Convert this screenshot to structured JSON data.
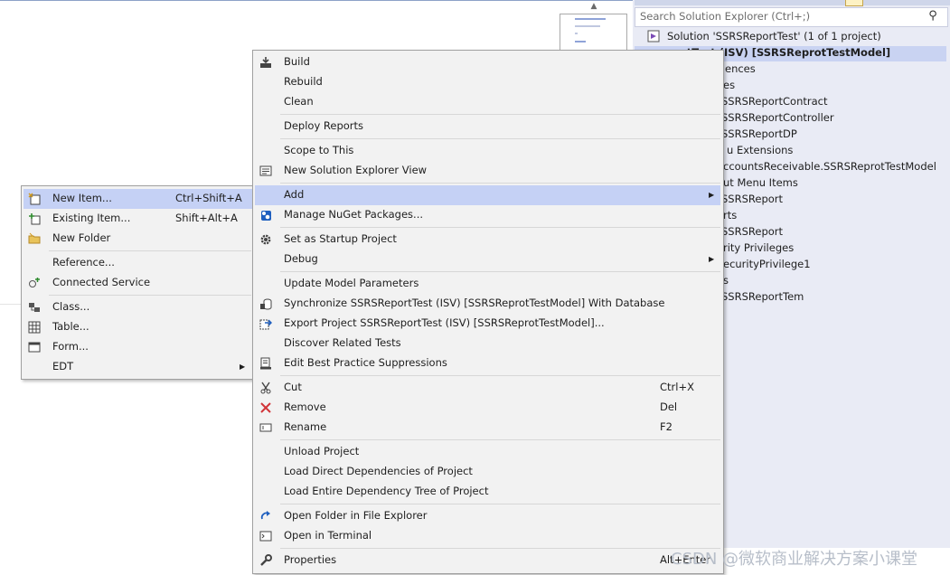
{
  "solution_explorer": {
    "search_placeholder": "Search Solution Explorer (Ctrl+;)",
    "items": [
      "Solution 'SSRSReportTest' (1 of 1 project)",
      "portTest (ISV) [SSRSReprotTestModel]",
      "ences",
      "es",
      "SSRSReportContract",
      "SSRSReportController",
      "SSRSReportDP",
      "u Extensions",
      "ccountsReceivable.SSRSReprotTestModel",
      "ut Menu Items",
      "SSRSReport",
      "rts",
      "SSRSReport",
      "rity Privileges",
      "ecurityPrivilege1",
      "s",
      "SSRSReportTem"
    ]
  },
  "context_menu": {
    "build": "Build",
    "rebuild": "Rebuild",
    "clean": "Clean",
    "deploy_reports": "Deploy Reports",
    "scope_to_this": "Scope to This",
    "new_solution_explorer_view": "New Solution Explorer View",
    "add": "Add",
    "manage_nuget": "Manage NuGet Packages...",
    "set_startup": "Set as Startup Project",
    "debug": "Debug",
    "update_model_parameters": "Update Model Parameters",
    "synchronize": "Synchronize SSRSReportTest (ISV) [SSRSReprotTestModel] With Database",
    "export_project": "Export Project SSRSReportTest (ISV) [SSRSReprotTestModel]...",
    "discover_related_tests": "Discover Related Tests",
    "edit_best_practice": "Edit Best Practice Suppressions",
    "cut": "Cut",
    "cut_shortcut": "Ctrl+X",
    "remove": "Remove",
    "remove_shortcut": "Del",
    "rename": "Rename",
    "rename_shortcut": "F2",
    "unload_project": "Unload Project",
    "load_direct": "Load Direct Dependencies of Project",
    "load_entire": "Load Entire Dependency Tree of Project",
    "open_folder": "Open Folder in File Explorer",
    "open_terminal": "Open in Terminal",
    "properties": "Properties",
    "properties_shortcut": "Alt+Enter"
  },
  "add_submenu": {
    "new_item": "New Item...",
    "new_item_shortcut": "Ctrl+Shift+A",
    "existing_item": "Existing Item...",
    "existing_item_shortcut": "Shift+Alt+A",
    "new_folder": "New Folder",
    "reference": "Reference...",
    "connected_service": "Connected Service",
    "class": "Class...",
    "table": "Table...",
    "form": "Form...",
    "edt": "EDT"
  },
  "watermark": "CSDN @微软商业解决方案小课堂",
  "colors": {
    "menu_bg": "#f2f2f2",
    "highlight": "#c5d1f5",
    "remove_red": "#d13438",
    "accent_blue": "#1f5fbf"
  }
}
